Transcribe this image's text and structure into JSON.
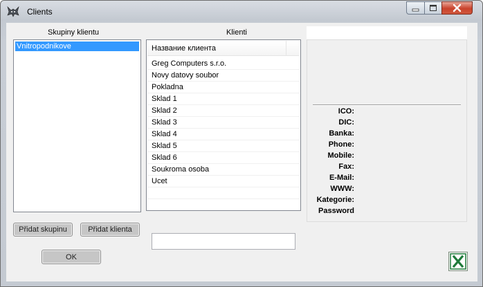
{
  "window": {
    "title": "Clients"
  },
  "icons": {
    "app": "wolf-app-icon",
    "minimize": "minimize-icon",
    "maximize": "maximize-icon",
    "close": "close-icon",
    "excel": "excel-export-icon"
  },
  "groups": {
    "label": "Skupiny klientu",
    "items": [
      "Vnitropodnikove"
    ]
  },
  "clients": {
    "label": "Klienti",
    "column_header": "Название клиента",
    "items": [
      "Greg Computers s.r.o.",
      "Novy datovy soubor",
      "Pokladna",
      "Sklad 1",
      "Sklad 2",
      "Sklad 3",
      "Sklad 4",
      "Sklad 5",
      "Sklad 6",
      "Soukroma osoba",
      "Ucet"
    ]
  },
  "info": {
    "labels": [
      "ICO:",
      "DIC:",
      "Banka:",
      "Phone:",
      "Mobile:",
      "Fax:",
      "E-Mail:",
      "WWW:",
      "Kategorie:",
      "Password"
    ]
  },
  "buttons": {
    "add_group": "Přidat skupinu",
    "add_client": "Přidat klienta",
    "ok": "OK"
  },
  "search": {
    "value": ""
  },
  "colors": {
    "selection": "#3399ff",
    "excel_green": "#1f7a3a"
  }
}
